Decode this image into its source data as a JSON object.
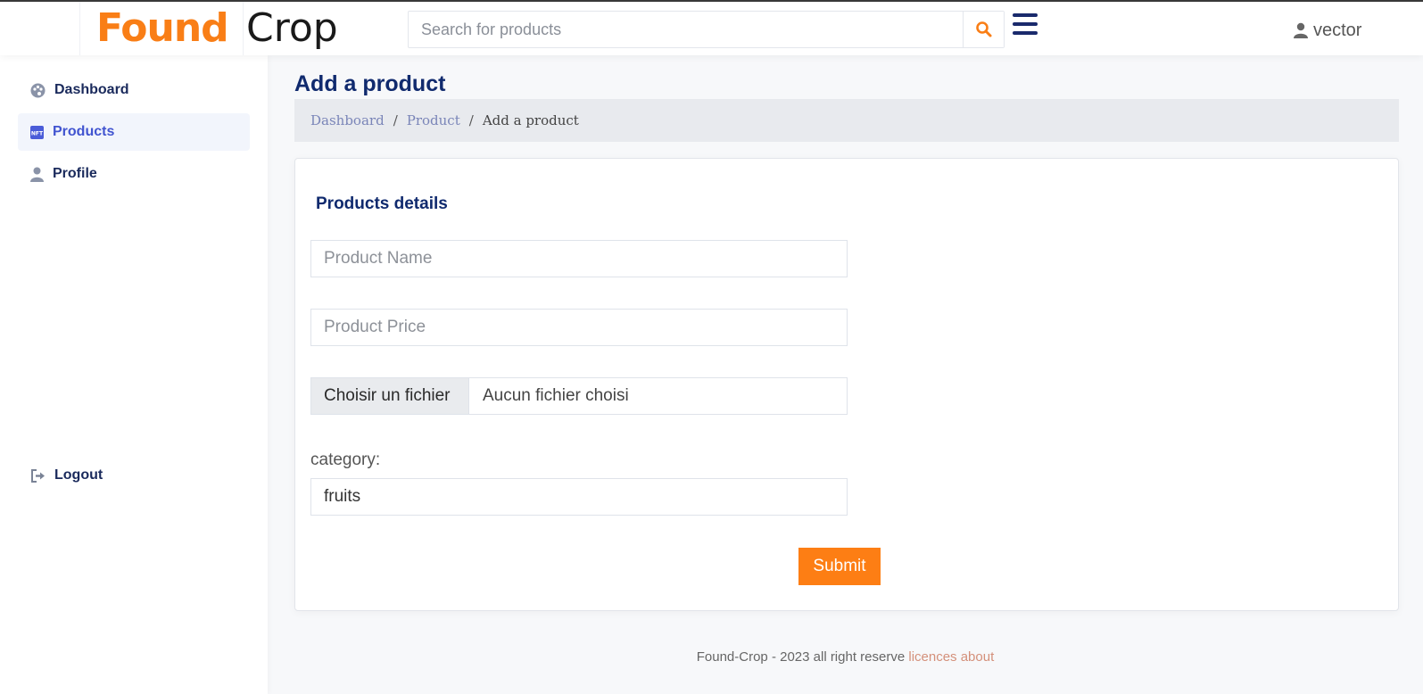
{
  "header": {
    "brand_part1": "Found",
    "brand_part2": "Crop",
    "search_placeholder": "Search for products",
    "search_icon": "search-icon",
    "menu_icon": "hamburger-icon",
    "user_icon": "user-icon",
    "username": "vector"
  },
  "sidebar": {
    "items": [
      {
        "label": "Dashboard",
        "icon": "palette-icon"
      },
      {
        "label": "Products",
        "icon": "nft-icon",
        "active": true
      },
      {
        "label": "Profile",
        "icon": "user-icon"
      }
    ],
    "logout": {
      "label": "Logout",
      "icon": "logout-icon"
    }
  },
  "page": {
    "title": "Add a product",
    "breadcrumb": {
      "dashboard": "Dashboard",
      "product": "Product",
      "current": "Add a product",
      "separator": "/"
    }
  },
  "form": {
    "section_title": "Products details",
    "product_name_placeholder": "Product Name",
    "product_price_placeholder": "Product Price",
    "file_button": "Choisir un fichier",
    "file_status": "Aucun fichier choisi",
    "category_label": "category:",
    "category_value": "fruits",
    "submit_label": "Submit"
  },
  "footer": {
    "text": "Found-Crop - 2023 all right reserve",
    "links": "licences about"
  },
  "colors": {
    "accent": "#fd7e14",
    "navy": "#102a6e",
    "active_link": "#4154d0"
  }
}
